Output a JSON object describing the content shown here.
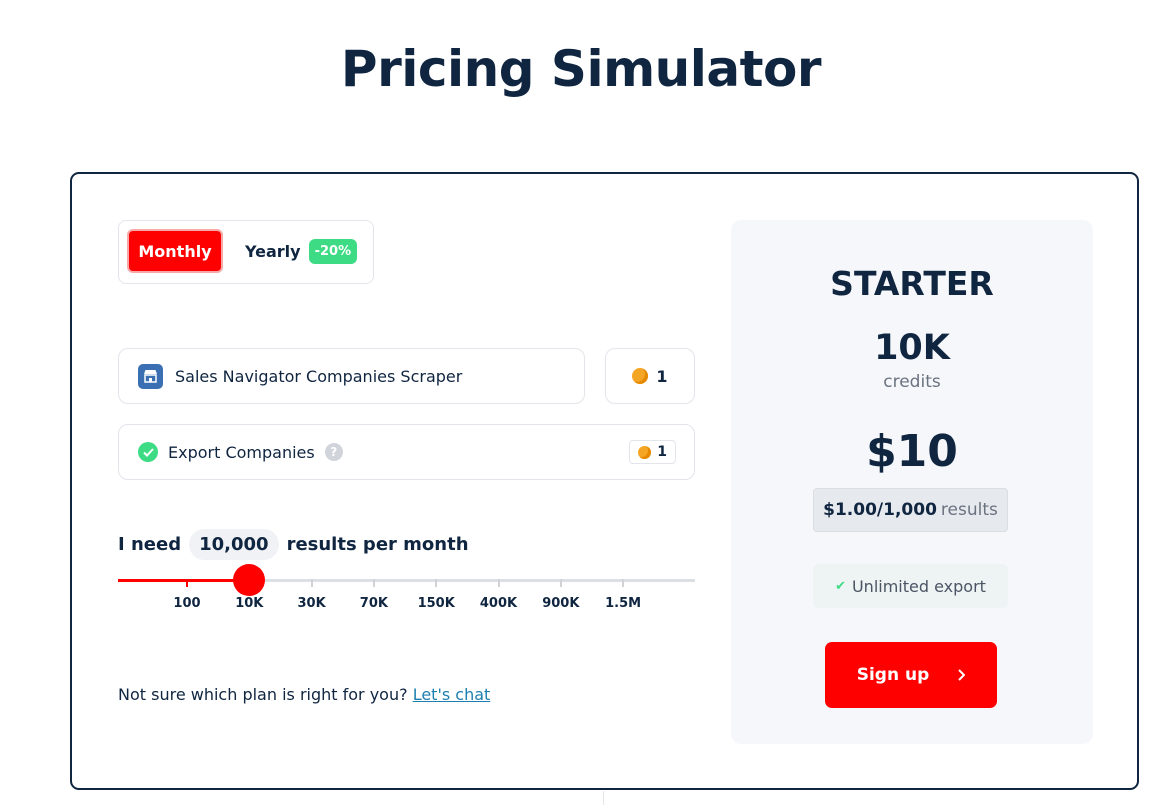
{
  "page": {
    "title": "Pricing Simulator"
  },
  "billing": {
    "monthly_label": "Monthly",
    "yearly_label": "Yearly",
    "yearly_discount": "-20%",
    "selected": "monthly"
  },
  "product": {
    "name": "Sales Navigator Companies Scraper",
    "credits": "1"
  },
  "export": {
    "label": "Export Companies",
    "help": "?",
    "credits": "1"
  },
  "volume": {
    "prefix": "I need",
    "value": "10,000",
    "suffix": "results per month",
    "ticks": [
      "100",
      "10K",
      "30K",
      "70K",
      "150K",
      "400K",
      "900K",
      "1.5M"
    ],
    "selected_index": 1
  },
  "help": {
    "text": "Not sure which plan is right for you?",
    "link": "Let's chat"
  },
  "plan": {
    "name": "STARTER",
    "credits": "10K",
    "credits_label": "credits",
    "price": "$10",
    "per_results_value": "$1.00/1,000",
    "per_results_unit": "results",
    "feature": "Unlimited export",
    "cta": "Sign up",
    "cta_icon": "chevron-right-icon"
  },
  "colors": {
    "accent": "#ff0000",
    "navy": "#0f2540",
    "success": "#3ddc84",
    "coin": "#f5a524",
    "link": "#1d7fb0"
  }
}
